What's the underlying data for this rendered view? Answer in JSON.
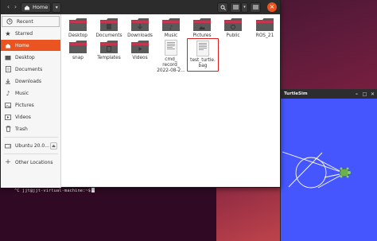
{
  "files_window": {
    "path_label": "Home",
    "sidebar": [
      {
        "label": "Recent",
        "icon": "clock-icon"
      },
      {
        "label": "Starred",
        "icon": "star-icon"
      },
      {
        "label": "Home",
        "icon": "home-icon"
      },
      {
        "label": "Desktop",
        "icon": "folder-icon"
      },
      {
        "label": "Documents",
        "icon": "document-icon"
      },
      {
        "label": "Downloads",
        "icon": "download-icon"
      },
      {
        "label": "Music",
        "icon": "music-icon"
      },
      {
        "label": "Pictures",
        "icon": "picture-icon"
      },
      {
        "label": "Videos",
        "icon": "video-icon"
      },
      {
        "label": "Trash",
        "icon": "trash-icon"
      },
      {
        "label": "Ubuntu 20.0...",
        "icon": "drive-icon"
      },
      {
        "label": "Other Locations",
        "icon": "plus-icon"
      }
    ],
    "items": [
      {
        "label": "Desktop",
        "kind": "folder"
      },
      {
        "label": "Documents",
        "kind": "folder"
      },
      {
        "label": "Downloads",
        "kind": "folder"
      },
      {
        "label": "Music",
        "kind": "folder"
      },
      {
        "label": "Pictures",
        "kind": "folder"
      },
      {
        "label": "Public",
        "kind": "folder"
      },
      {
        "label": "ROS_21",
        "kind": "folder"
      },
      {
        "label": "snap",
        "kind": "folder"
      },
      {
        "label": "Templates",
        "kind": "folder"
      },
      {
        "label": "Videos",
        "kind": "folder"
      },
      {
        "label": "cmd_\nrecord_\n2022-08-2...",
        "kind": "file"
      },
      {
        "label": "test_turtle.\nbag",
        "kind": "file"
      }
    ]
  },
  "terminal": {
    "prompt": "^C jjt@jjt-virtual-machine:~$"
  },
  "turtlesim": {
    "title": "TurtleSim",
    "background_color": "#4556ff"
  },
  "colors": {
    "accent": "#e95420",
    "selection_outline": "#d81e1e"
  }
}
